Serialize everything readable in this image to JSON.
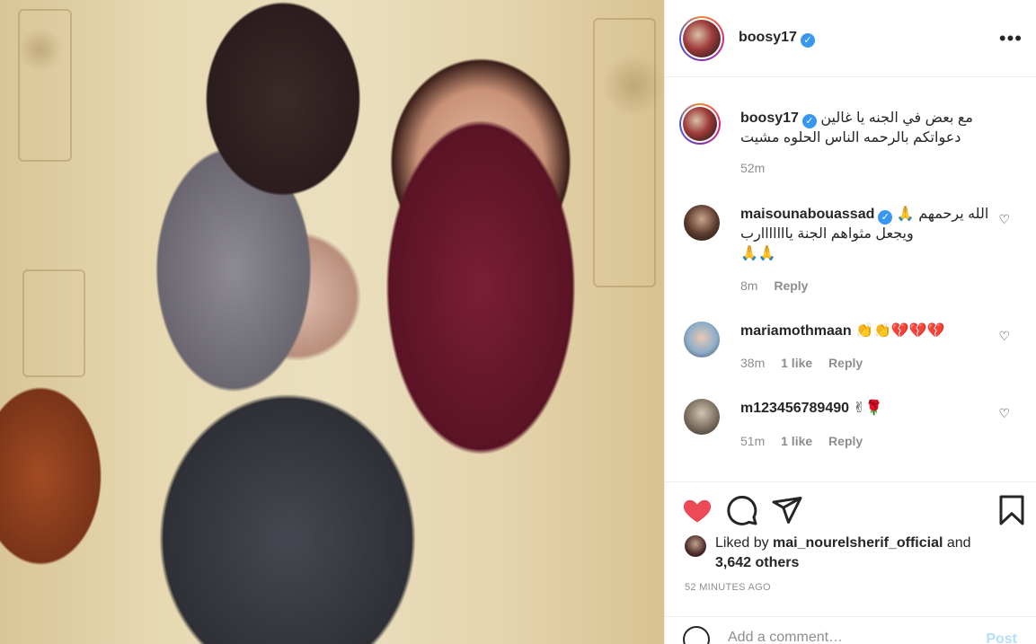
{
  "post": {
    "author": "boosy17",
    "caption_line1": "مع بعض في الجنه يا غالين",
    "caption_line2": "دعواتكم بالرحمه الناس الحلوه مشيت",
    "caption_time": "52m",
    "likes_prefix": "Liked by ",
    "liked_by_user": "mai_nourelsherif_official",
    "likes_and": " and",
    "likes_others": "3,642 others",
    "timestamp": "52 MINUTES AGO"
  },
  "comments": [
    {
      "user": "maisounabouassad",
      "verified": true,
      "line1": "الله يرحمهم 🙏",
      "line2": "ويجعل مثواهم الجنة يااااااارب",
      "line3": "🙏🙏",
      "time": "8m",
      "likes": "",
      "reply": "Reply"
    },
    {
      "user": "mariamothmaan",
      "text": "👏👏💔💔💔",
      "time": "38m",
      "likes": "1 like",
      "reply": "Reply"
    },
    {
      "user": "m123456789490",
      "text": "✌🌹",
      "time": "51m",
      "likes": "1 like",
      "reply": "Reply"
    }
  ],
  "add_comment": {
    "placeholder": "Add a comment…",
    "post_label": "Post"
  },
  "icons": {
    "more": "more-options-icon",
    "like": "heart-filled-icon",
    "comment": "comment-icon",
    "share": "send-icon",
    "save": "bookmark-icon"
  },
  "colors": {
    "like_red": "#ed4956",
    "verified_blue": "#3897f0",
    "post_button_disabled": "#b2dffc"
  }
}
